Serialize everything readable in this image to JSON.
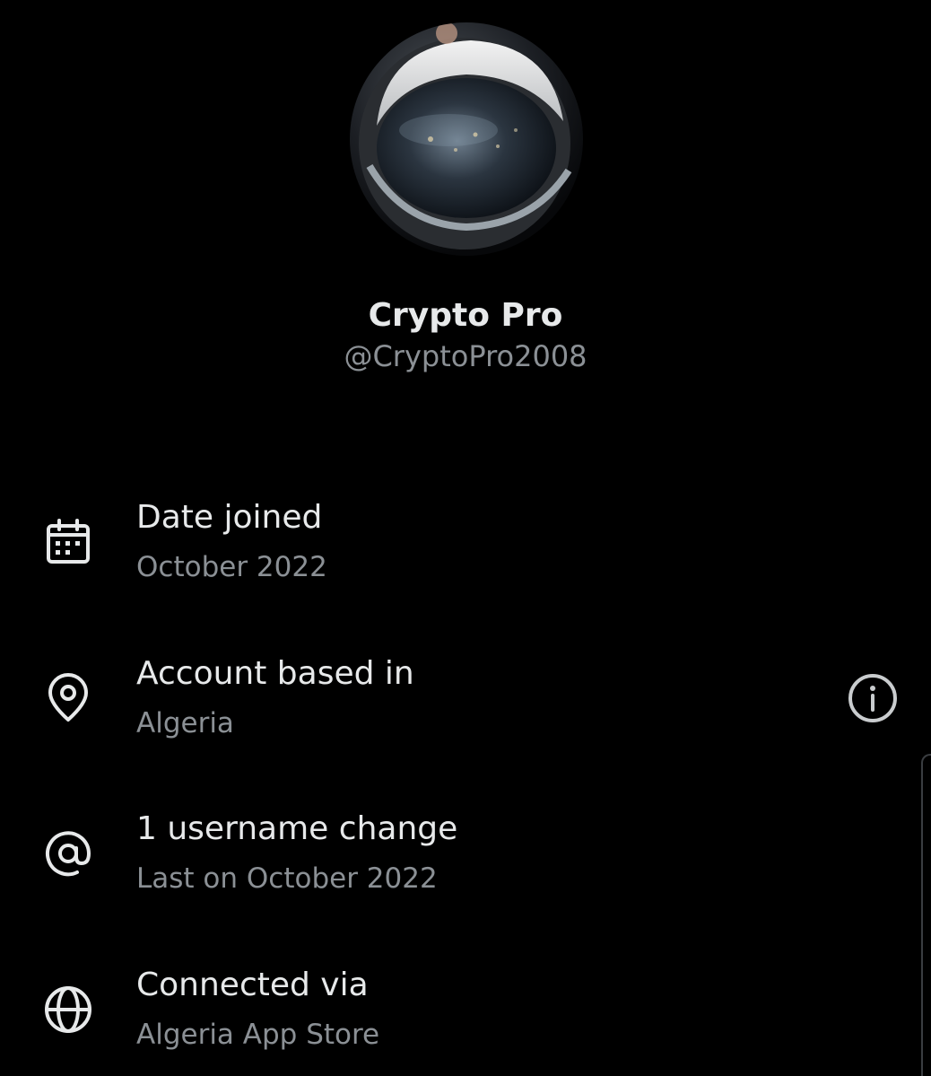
{
  "profile": {
    "display_name": "Crypto Pro",
    "handle": "@CryptoPro2008",
    "avatar_icon": "astronaut-helmet-avatar"
  },
  "rows": [
    {
      "icon": "calendar-icon",
      "title": "Date joined",
      "value": "October 2022"
    },
    {
      "icon": "location-pin-icon",
      "title": "Account based in",
      "value": "Algeria",
      "action_icon": "info-icon"
    },
    {
      "icon": "at-sign-icon",
      "title": "1 username change",
      "value": "Last on October 2022"
    },
    {
      "icon": "globe-icon",
      "title": "Connected via",
      "value": "Algeria App Store"
    }
  ],
  "colors": {
    "background": "#000000",
    "primary_text": "#e7e9ea",
    "secondary_text": "#8b9095"
  }
}
